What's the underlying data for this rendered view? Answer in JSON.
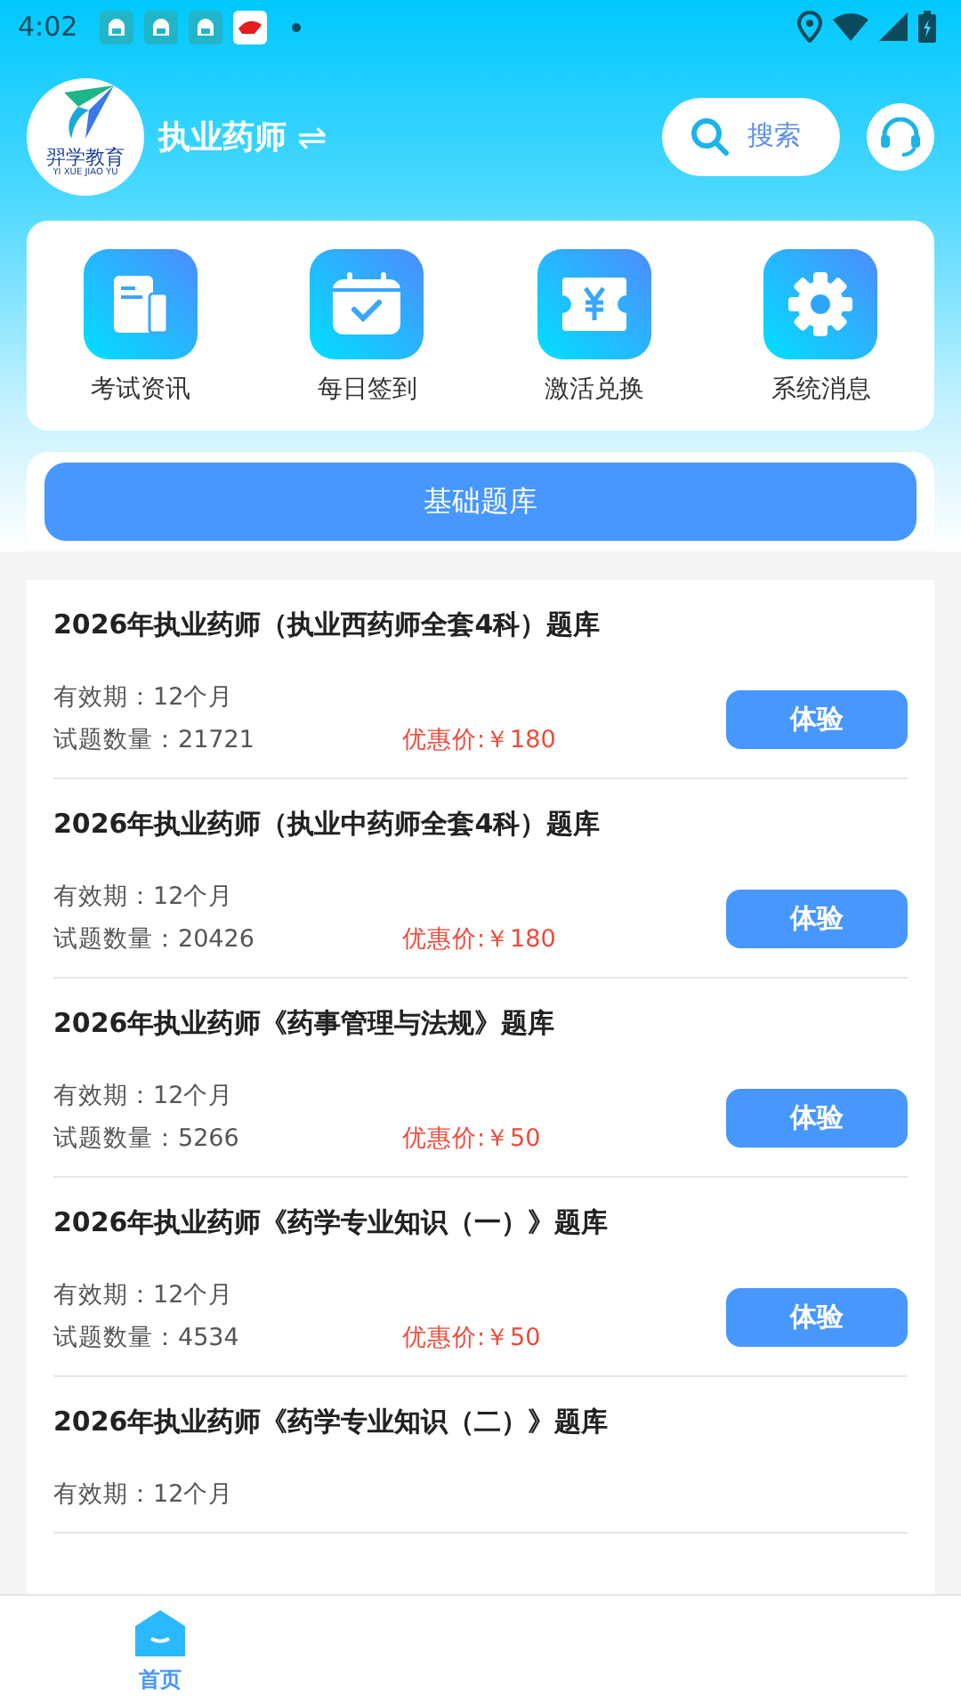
{
  "status_bar": {
    "time": "4:02"
  },
  "header": {
    "logo": {
      "name": "羿学教育",
      "pinyin": "YI XUE JIAO YU"
    },
    "title": "执业药师",
    "switch_glyph": "⇌",
    "search": {
      "label": "搜索"
    }
  },
  "shortcuts": [
    {
      "label": "考试资讯",
      "kind": "doc"
    },
    {
      "label": "每日签到",
      "kind": "calendar"
    },
    {
      "label": "激活兑换",
      "kind": "ticket"
    },
    {
      "label": "系统消息",
      "kind": "gear"
    }
  ],
  "bank_tabs": [
    {
      "label": "基础题库",
      "selected": true
    }
  ],
  "products": [
    {
      "title": "2026年执业药师（执业西药师全套4科）题库",
      "validity": "有效期：12个月",
      "count": "试题数量：21721",
      "price": "优惠价:￥180",
      "button": "体验"
    },
    {
      "title": "2026年执业药师（执业中药师全套4科）题库",
      "validity": "有效期：12个月",
      "count": "试题数量：20426",
      "price": "优惠价:￥180",
      "button": "体验"
    },
    {
      "title": "2026年执业药师《药事管理与法规》题库",
      "validity": "有效期：12个月",
      "count": "试题数量：5266",
      "price": "优惠价:￥50",
      "button": "体验"
    },
    {
      "title": "2026年执业药师《药学专业知识（一）》题库",
      "validity": "有效期：12个月",
      "count": "试题数量：4534",
      "price": "优惠价:￥50",
      "button": "体验"
    },
    {
      "title": "2026年执业药师《药学专业知识（二）》题库",
      "validity": "有效期：12个月"
    }
  ],
  "bottom_nav": [
    {
      "label": "首页",
      "selected": true
    }
  ]
}
